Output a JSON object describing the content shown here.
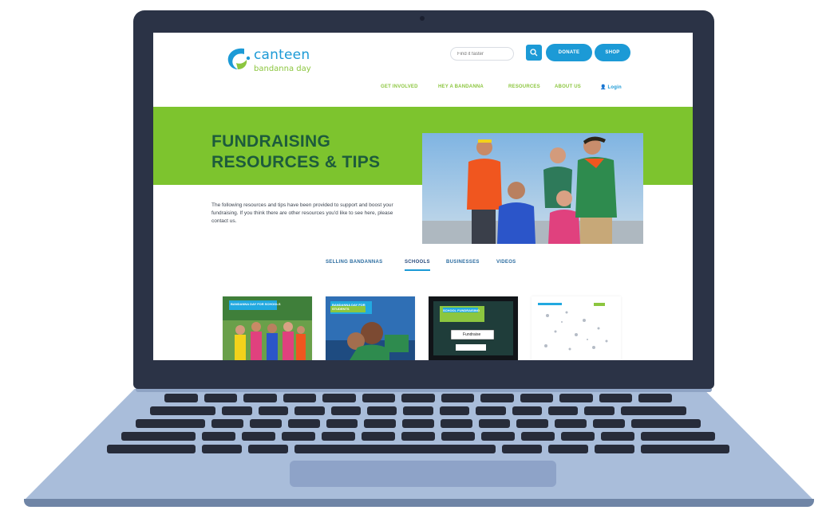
{
  "site": {
    "brand": "canteen",
    "brand_sub": "bandanna day",
    "search_placeholder": "Find it faster",
    "donate_label": "DONATE",
    "shop_label": "SHOP",
    "nav": [
      "GET INVOLVED",
      "HEY A BANDANNA",
      "RESOURCES",
      "ABOUT US",
      "Login"
    ],
    "hero_title": "FUNDRAISING RESOURCES & TIPS",
    "intro_text": "The following resources and tips have been provided to support and boost your fundraising. If you think there are other resources you'd like to see here, please contact us.",
    "tabs": [
      "SELLING BANDANNAS",
      "SCHOOLS",
      "BUSINESSES",
      "VIDEOS"
    ],
    "active_tab": "SCHOOLS",
    "cards": [
      {
        "caption": "BANDANNA DAY FOR SCHOOLS"
      },
      {
        "caption": "BANDANNA DAY FOR STUDENTS"
      },
      {
        "caption": "SCHOOL FUNDRAISING",
        "button": "Fundraise"
      },
      {
        "caption": ""
      }
    ]
  },
  "colors": {
    "brand_blue": "#1c9ad6",
    "brand_green": "#8cc63f",
    "hero_green": "#7dc42e",
    "title_dark_green": "#1d5b3c",
    "laptop_lid": "#2b3346",
    "laptop_base": "#a9bdda"
  }
}
